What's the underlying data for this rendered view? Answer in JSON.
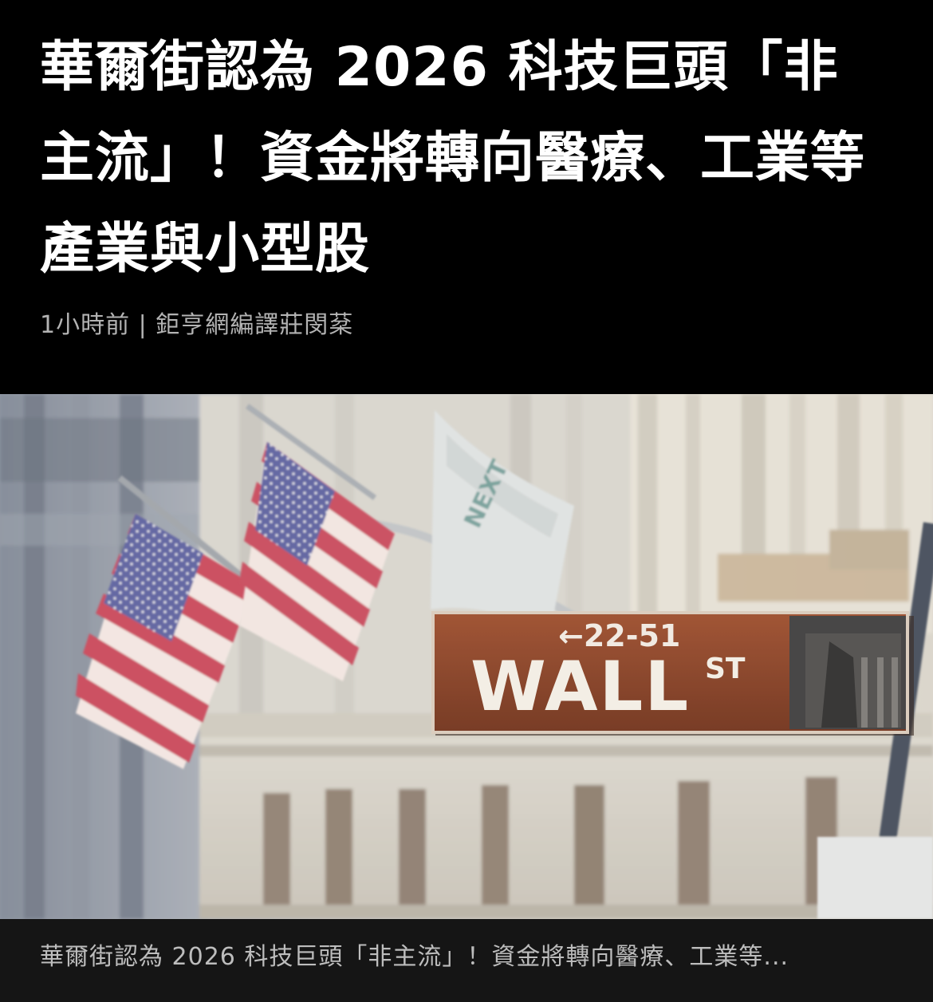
{
  "article": {
    "headline": "華爾街認為 2026 科技巨頭「非主流」！資金將轉向醫療、工業等產業與小型股",
    "meta": "1小時前 | 鉅亨網編譯莊閔棻"
  },
  "hero_image": {
    "sign_number": "←22-51",
    "sign_name": "WALL",
    "sign_suffix": "ST",
    "flag_text": "NEXT"
  },
  "caption": {
    "text": "華爾街認為 2026 科技巨頭「非主流」！資金將轉向醫療、工業等..."
  }
}
